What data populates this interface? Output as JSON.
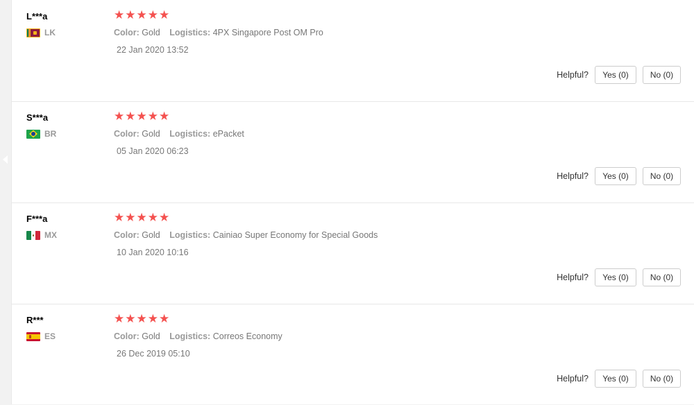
{
  "reviews": [
    {
      "user": "L***a",
      "country_code": "LK",
      "flag_icon": "sri-lanka-flag-icon",
      "rating": 5,
      "color_label": "Color:",
      "color_value": "Gold",
      "logistics_label": "Logistics:",
      "logistics_value": "4PX Singapore Post OM Pro",
      "date": "22 Jan 2020 13:52",
      "helpful_label": "Helpful?",
      "yes_label": "Yes (0)",
      "no_label": "No (0)"
    },
    {
      "user": "S***a",
      "country_code": "BR",
      "flag_icon": "brazil-flag-icon",
      "rating": 5,
      "color_label": "Color:",
      "color_value": "Gold",
      "logistics_label": "Logistics:",
      "logistics_value": "ePacket",
      "date": "05 Jan 2020 06:23",
      "helpful_label": "Helpful?",
      "yes_label": "Yes (0)",
      "no_label": "No (0)"
    },
    {
      "user": "F***a",
      "country_code": "MX",
      "flag_icon": "mexico-flag-icon",
      "rating": 5,
      "color_label": "Color:",
      "color_value": "Gold",
      "logistics_label": "Logistics:",
      "logistics_value": "Cainiao Super Economy for Special Goods",
      "date": "10 Jan 2020 10:16",
      "helpful_label": "Helpful?",
      "yes_label": "Yes (0)",
      "no_label": "No (0)"
    },
    {
      "user": "R***",
      "country_code": "ES",
      "flag_icon": "spain-flag-icon",
      "rating": 5,
      "color_label": "Color:",
      "color_value": "Gold",
      "logistics_label": "Logistics:",
      "logistics_value": "Correos Economy",
      "date": "26 Dec 2019 05:10",
      "helpful_label": "Helpful?",
      "yes_label": "Yes (0)",
      "no_label": "No (0)"
    }
  ],
  "colors": {
    "star": "#f4514f",
    "muted_text": "#999999",
    "body_text": "#777777",
    "divider": "#e8e8e8"
  }
}
